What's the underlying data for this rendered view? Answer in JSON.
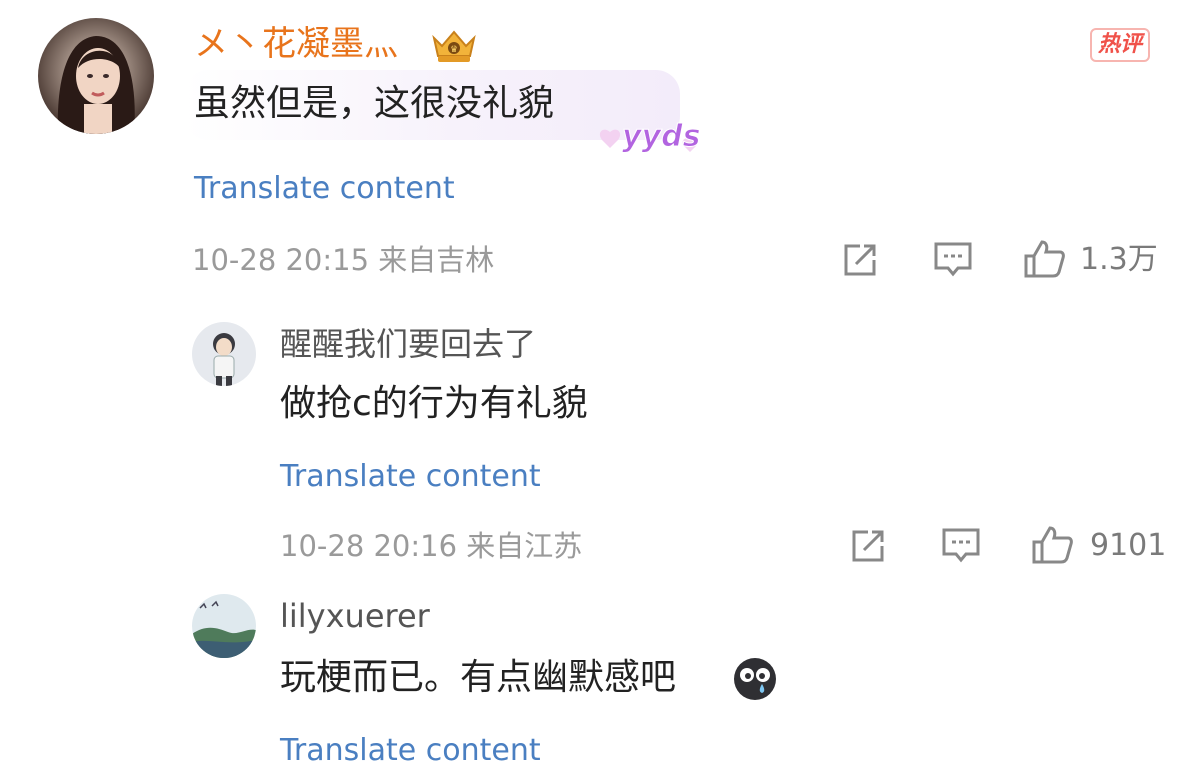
{
  "comments": [
    {
      "username": "メ丶花凝墨灬",
      "text": "虽然但是，这很没礼貌",
      "sticker": "yyds",
      "translate": "Translate content",
      "time": "10-28 20:15 来自吉林",
      "likes": "1.3万",
      "badge": "热评",
      "icons": [
        "crown-badge-icon",
        "share-icon",
        "comment-icon",
        "like-icon"
      ]
    },
    {
      "username": "醒醒我们要回去了",
      "text": "做抢c的行为有礼貌",
      "translate": "Translate content",
      "time": "10-28 20:16 来自江苏",
      "likes": "9101"
    },
    {
      "username": "lilyxuerer",
      "text": "玩梗而已。有点幽默感吧",
      "emoji": "crying-emoji-icon",
      "translate": "Translate content"
    }
  ],
  "colors": {
    "username_main": "#e8741c",
    "link": "#4a7fc1",
    "meta": "#9a9a9a",
    "hot": "#f0524a"
  }
}
